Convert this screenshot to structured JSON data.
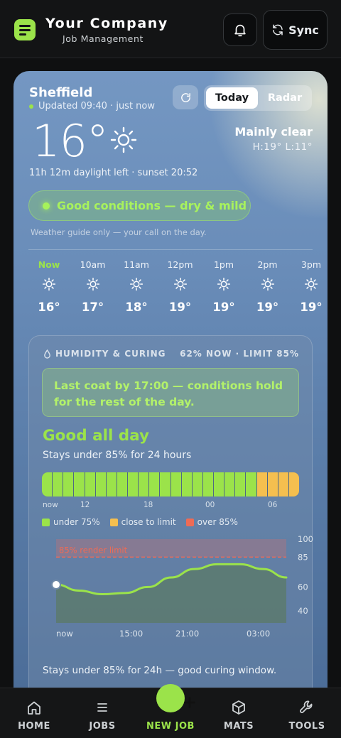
{
  "header": {
    "brand_name": "Your Company",
    "brand_sub": "Job Management",
    "sync_label": "Sync",
    "bell_icon": "bell-icon",
    "sync_icon": "sync-icon"
  },
  "weather": {
    "location": "Sheffield",
    "updated": "Updated 09:40 · just now",
    "tabs": {
      "today": "Today",
      "radar": "Radar",
      "active": "Today"
    },
    "temperature": "16°",
    "condition": "Mainly clear",
    "high_low": "H:19°  L:11°",
    "daylight": "11h 12m daylight left · sunset 20:52",
    "status_pill": "Good conditions — dry & mild",
    "guide_note": "Weather guide only — your call on the day.",
    "hourly": [
      {
        "time": "Now",
        "temp": "16°",
        "icon": "sun-icon"
      },
      {
        "time": "10am",
        "temp": "17°",
        "icon": "sun-icon"
      },
      {
        "time": "11am",
        "temp": "18°",
        "icon": "sun-icon"
      },
      {
        "time": "12pm",
        "temp": "19°",
        "icon": "sun-icon"
      },
      {
        "time": "1pm",
        "temp": "19°",
        "icon": "sun-icon"
      },
      {
        "time": "2pm",
        "temp": "19°",
        "icon": "sun-icon"
      },
      {
        "time": "3pm",
        "temp": "19°",
        "icon": "sun-icon"
      }
    ]
  },
  "humidity": {
    "heading": "HUMIDITY & CURING",
    "now_limit": "62% NOW · LIMIT 85%",
    "callout": "Last coat by 17:00 — conditions hold for the rest of the day.",
    "verdict": "Good all day",
    "verdict_sub": "Stays under 85% for 24 hours",
    "hour_blocks": [
      "under",
      "under",
      "under",
      "under",
      "under",
      "under",
      "under",
      "under",
      "under",
      "under",
      "under",
      "under",
      "under",
      "under",
      "under",
      "under",
      "under",
      "under",
      "under",
      "under",
      "close",
      "close",
      "close",
      "close",
      "close",
      "close",
      "close",
      "close",
      "close",
      "close",
      "under",
      "under",
      "under",
      "under",
      "under"
    ],
    "block_ticks": [
      "now",
      "12",
      "18",
      "00",
      "06"
    ],
    "legend": [
      {
        "label": "under 75%",
        "color": "#9be34a"
      },
      {
        "label": "close to limit",
        "color": "#f5bf4f"
      },
      {
        "label": "over 85%",
        "color": "#ef6b55"
      }
    ],
    "limit_label": "85% render limit",
    "footer": "Stays under 85% for 24h — good curing window."
  },
  "chart_data": {
    "type": "area",
    "title": "",
    "x": [
      "now",
      "03:00",
      "06:00",
      "09:00",
      "12:00",
      "15:00",
      "18:00",
      "21:00",
      "00:00",
      "03:00",
      "06:00"
    ],
    "x_tick_labels": [
      "now",
      "15:00",
      "21:00",
      "03:00"
    ],
    "values": [
      62,
      57,
      54,
      55,
      60,
      68,
      75,
      79,
      79,
      75,
      68
    ],
    "y_tick_labels": [
      "100",
      "85",
      "60",
      "40"
    ],
    "ylim": [
      30,
      100
    ],
    "threshold": {
      "value": 85,
      "label": "85% render limit",
      "color": "#ef6b55"
    },
    "series_color": "#9be34a"
  },
  "nav": {
    "items": [
      {
        "label": "HOME",
        "icon": "home-icon"
      },
      {
        "label": "JOBS",
        "icon": "list-icon"
      },
      {
        "label": "NEW JOB",
        "icon": "plus-icon"
      },
      {
        "label": "MATS",
        "icon": "box-icon"
      },
      {
        "label": "TOOLS",
        "icon": "wrench-icon"
      }
    ],
    "active": "NEW JOB"
  },
  "colors": {
    "accent": "#9be34a",
    "warning": "#f5bf4f",
    "danger": "#ef6b55"
  }
}
